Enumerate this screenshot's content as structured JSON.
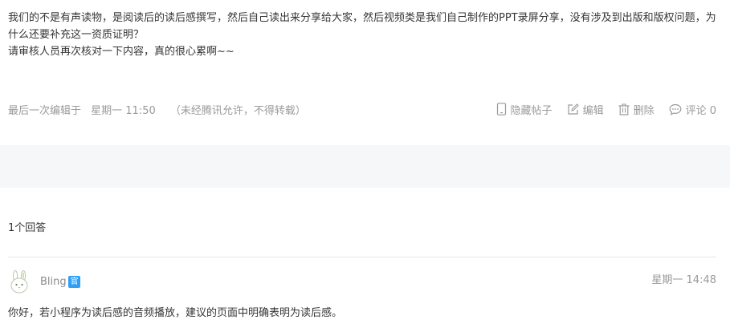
{
  "post": {
    "content_lines": [
      "我们的不是有声读物，是阅读后的读后感撰写，然后自己读出来分享给大家，然后视频类是我们自己制作的PPT录屏分享，没有涉及到出版和版权问题，为什么还要补充这一资质证明？",
      "请审核人员再次核对一下内容，真的很心累啊~~"
    ],
    "meta": {
      "edited_label": "最后一次编辑于",
      "edited_time": "星期一 11:50",
      "copyright_note": "（未经腾讯允许，不得转载）"
    },
    "actions": {
      "hide": "隐藏帖子",
      "edit": "编辑",
      "delete": "删除",
      "comment": "评论 0"
    }
  },
  "answers": {
    "count_label": "1个回答",
    "items": [
      {
        "user": "Bling",
        "badge": "官",
        "time": "星期一 14:48",
        "content": "你好，若小程序为读后感的音频播放，建议的页面中明确表明为读后感。"
      }
    ]
  },
  "colors": {
    "text": "#353535",
    "muted": "#9a9a9a",
    "separator_bg": "#f6f7f9",
    "badge": "#2f9ff6"
  },
  "icons": {
    "hide": "phone-icon",
    "edit": "pencil-square-icon",
    "delete": "trash-icon",
    "comment": "speech-bubble-icon",
    "avatar": "rabbit-avatar"
  }
}
